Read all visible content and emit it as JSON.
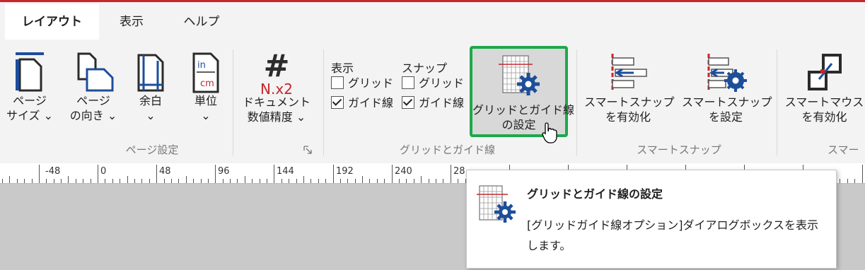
{
  "tabs": [
    {
      "label": "レイアウト",
      "active": true
    },
    {
      "label": "表示",
      "active": false
    },
    {
      "label": "ヘルプ",
      "active": false
    }
  ],
  "groups": {
    "page_setup": {
      "label": "ページ設定",
      "buttons": {
        "page_size": {
          "line1": "ページ",
          "line2": "サイズ ⌄"
        },
        "orientation": {
          "line1": "ページ",
          "line2": "の向き ⌄"
        },
        "margins": {
          "line1": "余白",
          "line2": "⌄"
        },
        "units": {
          "line1": "単位",
          "line2": "⌄"
        },
        "precision": {
          "line1": "ドキュメント",
          "line2": "数値精度 ⌄",
          "icon_text1": "#",
          "icon_text2": "N.x2"
        }
      }
    },
    "grid_guides": {
      "label": "グリッドとガイド線",
      "display_header": "表示",
      "snap_header": "スナップ",
      "display_grid": {
        "label": "グリッド",
        "checked": false
      },
      "display_guides": {
        "label": "ガイド線",
        "checked": true
      },
      "snap_grid": {
        "label": "グリッド",
        "checked": false
      },
      "snap_guides": {
        "label": "ガイド線",
        "checked": true
      },
      "settings_button": {
        "line1": "グリッドとガイド線",
        "line2": "の設定"
      }
    },
    "smart_snap": {
      "label": "スマートスナップ",
      "enable": {
        "line1": "スマートスナップ",
        "line2": "を有効化"
      },
      "settings": {
        "line1": "スマートスナップ",
        "line2": "を設定"
      }
    },
    "smart_mouse": {
      "label": "スマー",
      "enable": {
        "line1": "スマートマウス",
        "line2": "を有効化"
      }
    }
  },
  "ruler": {
    "labels": [
      "-48",
      "0",
      "48",
      "96",
      "144",
      "192",
      "240",
      "28"
    ]
  },
  "tooltip": {
    "title": "グリッドとガイド線の設定",
    "description": "[グリッドガイド線オプション]ダイアログボックスを表示します。"
  },
  "colors": {
    "accent_red": "#c4262e",
    "highlight_green": "#1ea84b",
    "icon_blue": "#1d4e9a",
    "icon_dark": "#2b2b2b"
  }
}
